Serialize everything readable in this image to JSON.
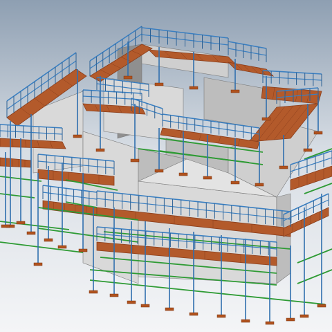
{
  "viewport": {
    "background_top": "#8e9fb2",
    "background_mid": "#d7dde4",
    "background_bottom": "#f4f5f7"
  },
  "colors": {
    "wall_light": "#d9d9d9",
    "wall_mid": "#bdbdbd",
    "wall_dark": "#8f8f8f",
    "wall_top": "#cfcfcf",
    "plank": "#b35a2b",
    "plank_dark": "#8a3e1c",
    "guardrail": "#3a7fc1",
    "guardrail_dark": "#2a5f93",
    "ledger": "#2e9b34",
    "standard": "#2f6fae",
    "base_plate": "#b0521e"
  },
  "model": {
    "building_name": "",
    "scaffold_levels": 3,
    "view_mode": "3d-perspective"
  }
}
